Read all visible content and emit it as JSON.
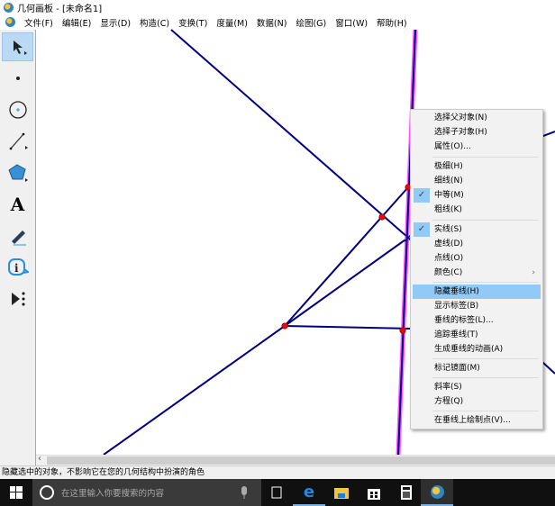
{
  "window": {
    "title": "几何画板 - [未命名1]"
  },
  "menubar": [
    "文件(F)",
    "编辑(E)",
    "显示(D)",
    "构造(C)",
    "变换(T)",
    "度量(M)",
    "数据(N)",
    "绘图(G)",
    "窗口(W)",
    "帮助(H)"
  ],
  "toolbar": [
    "arrow-select",
    "point",
    "compass",
    "straightedge",
    "polygon",
    "text",
    "marker",
    "information",
    "custom-tools"
  ],
  "context_menu": {
    "items": [
      {
        "label": "选择父对象(N)"
      },
      {
        "label": "选择子对象(H)"
      },
      {
        "label": "属性(O)..."
      },
      {
        "label": "极细(H)"
      },
      {
        "label": "细线(N)"
      },
      {
        "label": "中等(M)",
        "checked": true
      },
      {
        "label": "粗线(K)"
      },
      {
        "label": "实线(S)",
        "checked": true
      },
      {
        "label": "虚线(D)"
      },
      {
        "label": "点线(O)"
      },
      {
        "label": "颜色(C)",
        "submenu": true
      },
      {
        "label": "隐藏垂线(H)",
        "highlighted": true
      },
      {
        "label": "显示标签(B)"
      },
      {
        "label": "垂线的标签(L)..."
      },
      {
        "label": "追踪垂线(T)"
      },
      {
        "label": "生成垂线的动画(A)"
      },
      {
        "label": "标记镜面(M)"
      },
      {
        "label": "斜率(S)"
      },
      {
        "label": "方程(Q)"
      },
      {
        "label": "在垂线上绘制点(V)..."
      }
    ],
    "check_mark": "✓",
    "submenu_arrow": "›"
  },
  "status_text": "隐藏选中的对象，不影响它在您的几何结构中扮演的角色",
  "taskbar": {
    "search_placeholder": "在这里输入你要搜索的内容"
  },
  "colors": {
    "line": "#000080",
    "point": "#ff0000",
    "selection": "#ff44ff",
    "menu_highlight": "#91c9f7"
  }
}
